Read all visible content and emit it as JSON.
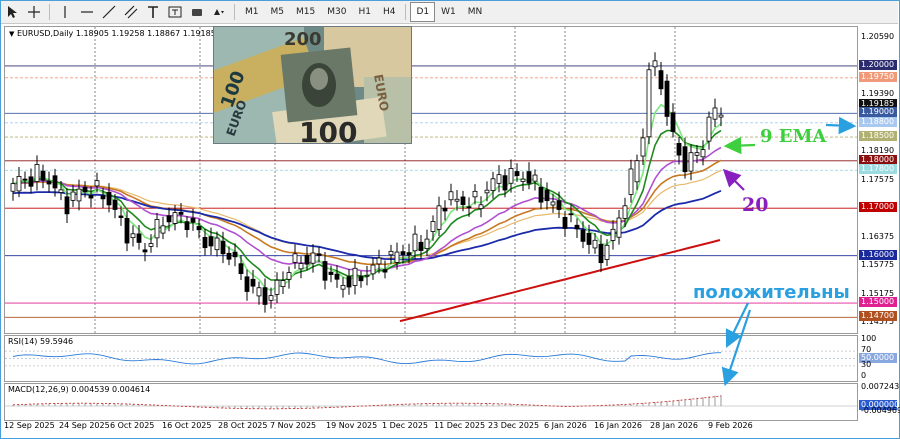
{
  "toolbar": {
    "tools": [
      {
        "name": "cursor-icon"
      },
      {
        "name": "crosshair-icon"
      },
      {
        "name": "vertical-line-icon"
      },
      {
        "name": "horizontal-line-icon"
      },
      {
        "name": "trend-line-icon"
      },
      {
        "name": "channel-icon"
      },
      {
        "name": "text-icon"
      },
      {
        "name": "text-label-icon"
      },
      {
        "name": "rectangle-icon"
      },
      {
        "name": "shapes-menu-icon"
      }
    ],
    "timeframes": [
      "M1",
      "M5",
      "M15",
      "M30",
      "H1",
      "H4",
      "D1",
      "W1",
      "MN"
    ],
    "active_timeframe": "D1"
  },
  "chart": {
    "symbol_line": "EURUSD,Daily  1.18905 1.19258 1.18867 1.19185",
    "price_ticks": [
      "1.20590",
      "1.19390",
      "1.18190",
      "1.17575",
      "1.16375",
      "1.15775",
      "1.15175",
      "1.14575"
    ],
    "price_badges": [
      {
        "label": "1.20000",
        "color": "#2b2b70"
      },
      {
        "label": "1.19750",
        "color": "#f09a7a"
      },
      {
        "label": "1.19185",
        "color": "#111111"
      },
      {
        "label": "1.19000",
        "color": "#3a5aa0"
      },
      {
        "label": "1.18800",
        "color": "#a8c8f0"
      },
      {
        "label": "1.18500",
        "color": "#b0b070"
      },
      {
        "label": "1.18000",
        "color": "#8a1010"
      },
      {
        "label": "1.17800",
        "color": "#9adce0"
      },
      {
        "label": "1.17000",
        "color": "#c00000"
      },
      {
        "label": "1.16000",
        "color": "#1a2a9a"
      },
      {
        "label": "1.15000",
        "color": "#e02090"
      },
      {
        "label": "1.14700",
        "color": "#b05020"
      }
    ],
    "colors": {
      "candle": "#000000",
      "ema9": "#7de87d",
      "ema20": "#1e8a1e",
      "ema_purple": "#b050d0",
      "ema_brown": "#c87820",
      "ema_tan": "#e8b868",
      "ema_blue": "#1a2aaa",
      "ema_red": "#cc1010",
      "annotation_green": "#3ecf3e",
      "annotation_purple": "#8a1fc0",
      "annotation_blue": "#2aa0e0"
    }
  },
  "annotations": {
    "ema9": "9 EMA",
    "twenty": "20",
    "positive": "положительны"
  },
  "rsi": {
    "label": "RSI(14) 59.5946",
    "levels": [
      "100",
      "70",
      "50.0000",
      "30",
      "0"
    ]
  },
  "macd": {
    "label": "MACD(12,26,9) 0.004539 0.004614",
    "levels": [
      "0.007243",
      "0.000000",
      "-0.004969"
    ]
  },
  "dates": [
    "12 Sep 2025",
    "24 Sep 2025",
    "6 Oct 2025",
    "16 Oct 2025",
    "28 Oct 2025",
    "7 Nov 2025",
    "19 Nov 2025",
    "1 Dec 2025",
    "11 Dec 2025",
    "23 Dec 2025",
    "6 Jan 2026",
    "16 Jan 2026",
    "28 Jan 2026",
    "9 Feb 2026"
  ]
}
